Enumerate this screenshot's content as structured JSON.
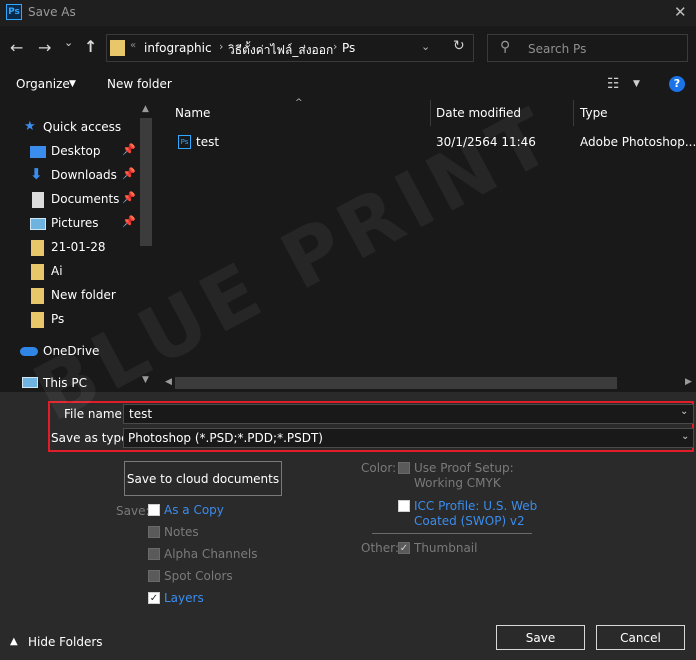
{
  "window": {
    "title": "Save As",
    "app_icon_text": "Ps",
    "close_glyph": "✕"
  },
  "nav": {
    "back_glyph": "←",
    "forward_glyph": "→",
    "recent_glyph": "⌄",
    "up_glyph": "↑",
    "address": {
      "overflow_glyph": "«",
      "crumbs": [
        "infographic",
        "วิธีตั้งค่าไฟล์_ส่งออก",
        "Ps"
      ],
      "sep_glyph": "›",
      "dropdown_glyph": "⌄",
      "refresh_glyph": "↻"
    },
    "search": {
      "placeholder": "Search Ps",
      "icon_glyph": "⚲"
    }
  },
  "toolbar": {
    "organize_label": "Organize",
    "organize_caret": "▼",
    "new_folder_label": "New folder",
    "view_glyph": "☷",
    "view_caret": "▼",
    "help_glyph": "?"
  },
  "navpane": {
    "items": [
      {
        "label": "Quick access",
        "icon": "star-icon",
        "pinned": false
      },
      {
        "label": "Desktop",
        "icon": "desktop-icon",
        "pinned": true
      },
      {
        "label": "Downloads",
        "icon": "download-icon",
        "pinned": true
      },
      {
        "label": "Documents",
        "icon": "document-icon",
        "pinned": true
      },
      {
        "label": "Pictures",
        "icon": "picture-icon",
        "pinned": true
      },
      {
        "label": "21-01-28",
        "icon": "folder-icon",
        "pinned": false
      },
      {
        "label": "Ai",
        "icon": "folder-icon",
        "pinned": false
      },
      {
        "label": "New folder",
        "icon": "folder-icon",
        "pinned": false
      },
      {
        "label": "Ps",
        "icon": "folder-icon",
        "pinned": false
      },
      {
        "label": "OneDrive",
        "icon": "cloud-icon",
        "pinned": false
      },
      {
        "label": "This PC",
        "icon": "computer-icon",
        "pinned": false
      }
    ],
    "pin_glyph": "📌"
  },
  "filelist": {
    "columns": [
      "Name",
      "Date modified",
      "Type"
    ],
    "sort_caret": "^",
    "rows": [
      {
        "name": "test",
        "date_modified": "30/1/2564 11:46",
        "type": "Adobe Photoshop..."
      }
    ],
    "file_icon_text": "Ps"
  },
  "form": {
    "filename_label": "File name:",
    "filename_value": "test",
    "savetype_label": "Save as type:",
    "savetype_value": "Photoshop (*.PSD;*.PDD;*.PSDT)",
    "dropdown_glyph": "⌄"
  },
  "options": {
    "cloud_button_label": "Save to cloud documents",
    "save_label": "Save:",
    "save_options": [
      {
        "label": "As a Copy",
        "checked": false,
        "enabled": true
      },
      {
        "label": "Notes",
        "checked": false,
        "enabled": false
      },
      {
        "label": "Alpha Channels",
        "checked": false,
        "enabled": false
      },
      {
        "label": "Spot Colors",
        "checked": false,
        "enabled": false
      },
      {
        "label": "Layers",
        "checked": true,
        "enabled": true
      }
    ],
    "color_label": "Color:",
    "proof_setup_line1": "Use Proof Setup:",
    "proof_setup_line2": "Working CMYK",
    "icc_line1": "ICC Profile:  U.S. Web",
    "icc_line2": "Coated (SWOP) v2",
    "other_label": "Other:",
    "thumbnail_label": "Thumbnail",
    "check_glyph": "✓"
  },
  "footer": {
    "hide_folders_label": "Hide Folders",
    "hide_caret": "▲",
    "save_label": "Save",
    "cancel_label": "Cancel"
  },
  "watermark": {
    "text": "BLUE PRINT"
  },
  "colors": {
    "accent": "#3b8ded",
    "highlight": "#e11d2a",
    "folder": "#e8c76a",
    "ps_blue": "#31a8ff"
  }
}
